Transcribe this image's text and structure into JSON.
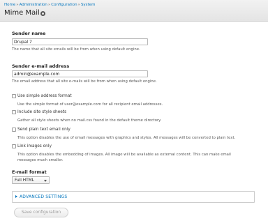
{
  "breadcrumb": [
    "Home",
    "Administration",
    "Configuration",
    "System"
  ],
  "breadcrumb_separator": "»",
  "page_title": "Mime Mail",
  "title_icon": "gear-icon",
  "sender_name": {
    "label": "Sender name",
    "value": "Drupal 7",
    "description": "The name that all site emails will be from when using default engine."
  },
  "sender_email": {
    "label": "Sender e-mail address",
    "value": "admin@example.com",
    "description": "The email address that all site e-mails will be from when using default engine."
  },
  "options": [
    {
      "label": "Use simple address format",
      "checked": false,
      "description": "Use the simple format of user@example.com for all recipient email addresses."
    },
    {
      "label": "Include site style sheets",
      "checked": false,
      "description": "Gather all style sheets when no mail.css found in the default theme directory."
    },
    {
      "label": "Send plain text email only",
      "checked": false,
      "description": "This option disables the use of email messages with graphics and styles. All messages will be converted to plain text."
    },
    {
      "label": "Link images only",
      "checked": false,
      "description_lines": [
        "This option disables the embedding of images. All image will be available as external content. This can make email",
        "messages much smaller."
      ]
    }
  ],
  "email_format": {
    "label": "E-mail format",
    "value": "Full HTML"
  },
  "advanced_settings": {
    "label": "ADVANCED SETTINGS",
    "collapsed": true
  },
  "save_button": {
    "label": "Save configuration"
  },
  "colors": {
    "link": "#0074bd",
    "header_bg": "#e9e9e9"
  }
}
